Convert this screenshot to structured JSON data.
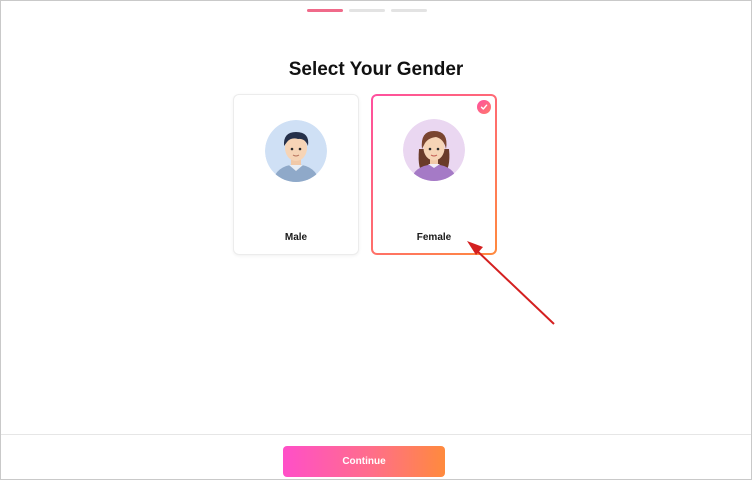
{
  "progress": {
    "steps": 3,
    "current": 1
  },
  "page": {
    "title": "Select Your Gender"
  },
  "options": [
    {
      "label": "Male",
      "selected": false,
      "avatar_icon": "male-avatar-icon"
    },
    {
      "label": "Female",
      "selected": true,
      "avatar_icon": "female-avatar-icon"
    }
  ],
  "footer": {
    "continue_label": "Continue"
  },
  "colors": {
    "accent_pink": "#ff4fa0",
    "accent_orange": "#ff8a3d",
    "annotation_arrow": "#d42020"
  }
}
